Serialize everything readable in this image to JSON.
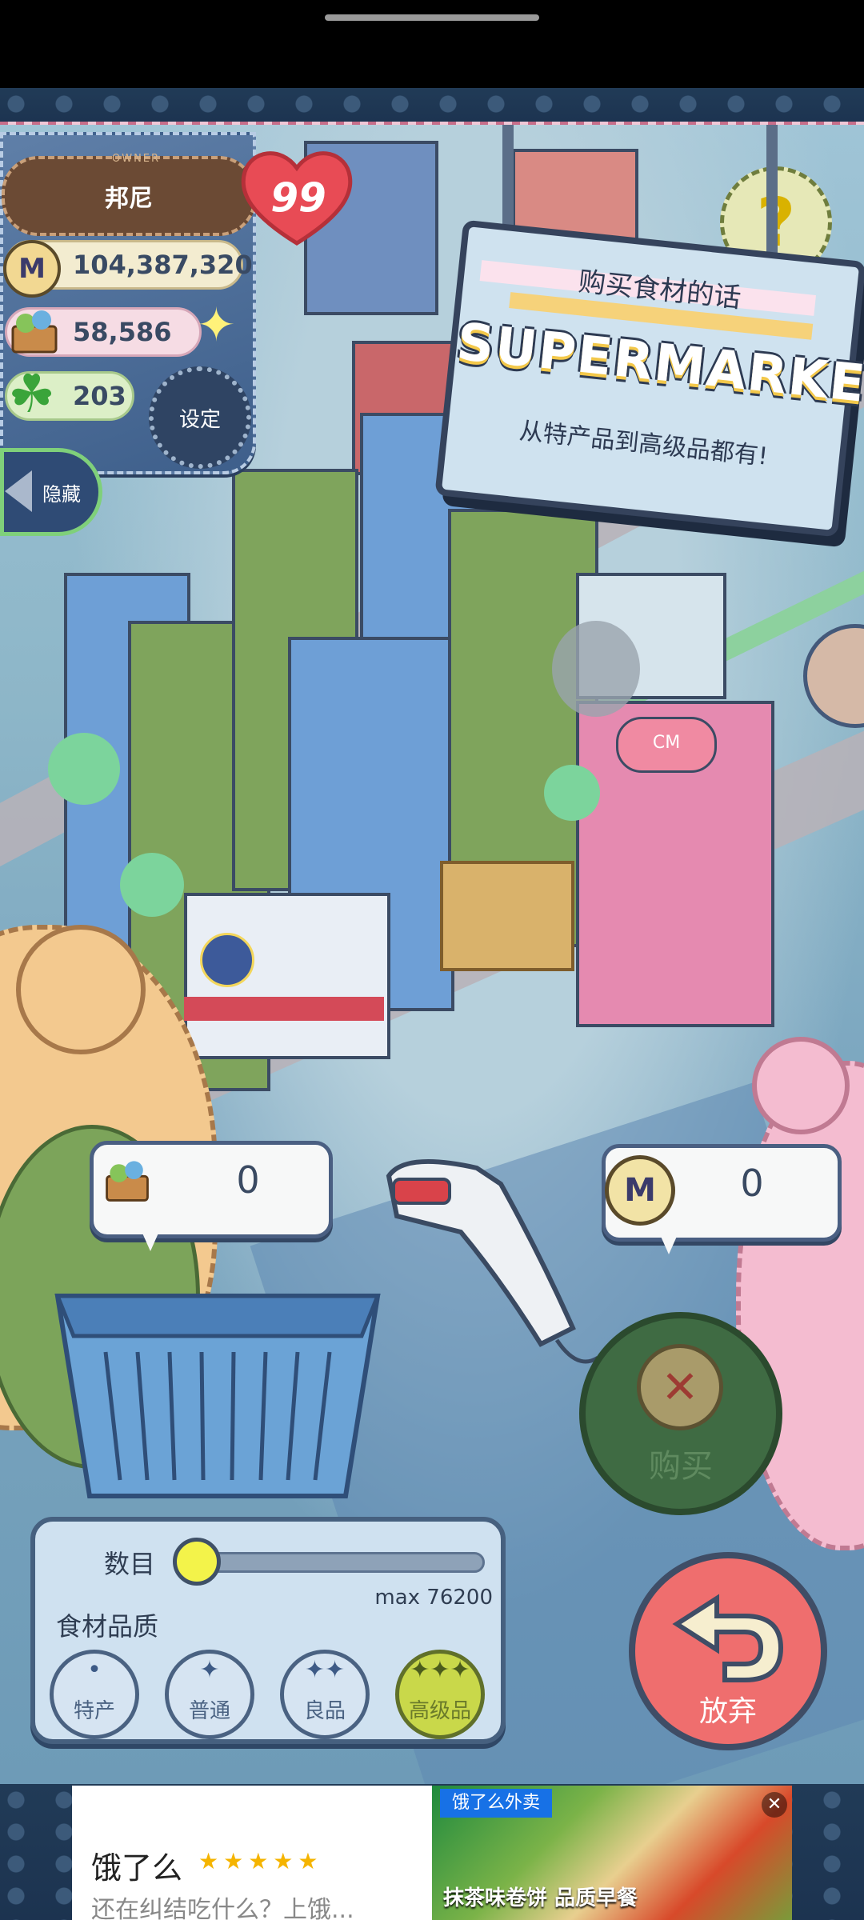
{
  "owner": {
    "caption": "OWNER",
    "name": "邦尼",
    "level": "99",
    "money": "104,387,320",
    "food": "58,586",
    "clover": "203",
    "settings_label": "设定",
    "hide_label": "隐藏"
  },
  "sign": {
    "line1": "购买食材的话",
    "title": "SUPERMARKET",
    "line2": "从特产品到高级品都有!"
  },
  "help": {
    "label": "?"
  },
  "cart": {
    "basket_count": "0",
    "price": "0",
    "coin_symbol": "M"
  },
  "buy": {
    "label": "购买",
    "icon": "x-icon"
  },
  "quantity": {
    "label": "数目",
    "value": 0,
    "max_label": "max 76200"
  },
  "quality": {
    "label": "食材品质",
    "options": [
      {
        "label": "特产",
        "glyph": "•"
      },
      {
        "label": "普通",
        "glyph": "✦"
      },
      {
        "label": "良品",
        "glyph": "✦✦"
      },
      {
        "label": "高级品",
        "glyph": "✦✦✦",
        "selected": true
      }
    ]
  },
  "cancel": {
    "label": "放弃"
  },
  "ad": {
    "title": "饿了么",
    "stars": "★★★★★",
    "description": "还在纠结吃什么？上饿...",
    "brand": "饿了么外卖",
    "caption": "抹茶味卷饼 品质早餐",
    "close": "✕"
  },
  "colors": {
    "panel": "#46607f",
    "buy": "#3f6b43",
    "cancel": "#ef6e6e",
    "selected_quality": "#c9d84a"
  }
}
